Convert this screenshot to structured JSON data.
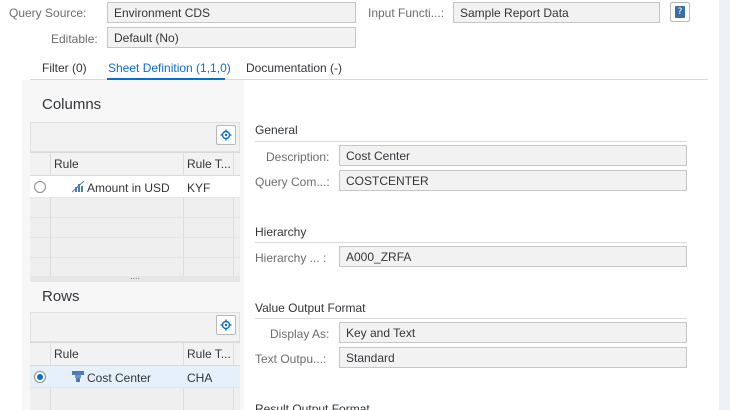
{
  "header": {
    "query_source_label": "Query Source:",
    "query_source_value": "Environment CDS",
    "input_function_label": "Input Functi...:",
    "input_function_value": "Sample Report Data",
    "editable_label": "Editable:",
    "editable_value": "Default (No)"
  },
  "tabs": [
    {
      "label": "Filter (0)"
    },
    {
      "label": "Sheet Definition (1,1,0)"
    },
    {
      "label": "Documentation (-)"
    }
  ],
  "columns": {
    "title": "Columns",
    "col_rule": "Rule",
    "col_type": "Rule T...",
    "rows": [
      {
        "name": "Amount in USD",
        "type": "KYF",
        "icon": "key-figure-icon",
        "selected": false
      }
    ],
    "resize_grip": "...."
  },
  "rows": {
    "title": "Rows",
    "col_rule": "Rule",
    "col_type": "Rule T...",
    "rows": [
      {
        "name": "Cost Center",
        "type": "CHA",
        "icon": "characteristic-icon",
        "selected": true
      }
    ]
  },
  "details": {
    "general_title": "General",
    "description_label": "Description:",
    "description_value": "Cost Center",
    "query_comp_label": "Query Com...:",
    "query_comp_value": "COSTCENTER",
    "hierarchy_title": "Hierarchy",
    "hierarchy_label": "Hierarchy ...  :",
    "hierarchy_value": "A000_ZRFA",
    "value_output_title": "Value Output Format",
    "display_as_label": "Display As:",
    "display_as_value": "Key and Text",
    "text_output_label": "Text Outpu...:",
    "text_output_value": "Standard",
    "result_output_title": "Result Output Format"
  },
  "colors": {
    "accent": "#0a6ed1",
    "field_bg": "#f2f2f2",
    "panel_bg": "#f7f7f7"
  }
}
